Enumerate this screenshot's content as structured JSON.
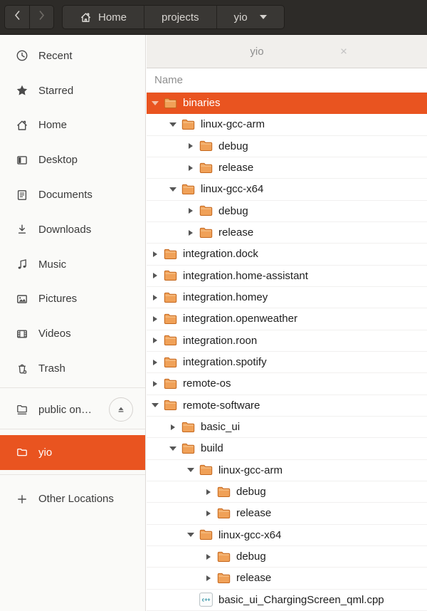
{
  "colors": {
    "accent_orange": "#E95420",
    "header_bg": "#2D2B28",
    "folder_fill": "#F0A158",
    "folder_stroke": "#C4671D",
    "cpp_icon_text": "#2E91A4"
  },
  "header": {
    "back_icon": "chevron-left",
    "forward_icon": "chevron-right",
    "path": [
      {
        "label": "Home",
        "icon": "home"
      },
      {
        "label": "projects"
      },
      {
        "label": "yio",
        "has_caret": true
      }
    ]
  },
  "tab": {
    "title": "yio",
    "close_glyph": "×"
  },
  "list": {
    "column_header": "Name",
    "rows": [
      {
        "name": "binaries",
        "level": 0,
        "state": "expanded",
        "type": "folder",
        "selected": true
      },
      {
        "name": "linux-gcc-arm",
        "level": 1,
        "state": "expanded",
        "type": "folder"
      },
      {
        "name": "debug",
        "level": 2,
        "state": "collapsed",
        "type": "folder"
      },
      {
        "name": "release",
        "level": 2,
        "state": "collapsed",
        "type": "folder"
      },
      {
        "name": "linux-gcc-x64",
        "level": 1,
        "state": "expanded",
        "type": "folder"
      },
      {
        "name": "debug",
        "level": 2,
        "state": "collapsed",
        "type": "folder"
      },
      {
        "name": "release",
        "level": 2,
        "state": "collapsed",
        "type": "folder"
      },
      {
        "name": "integration.dock",
        "level": 0,
        "state": "collapsed",
        "type": "folder"
      },
      {
        "name": "integration.home-assistant",
        "level": 0,
        "state": "collapsed",
        "type": "folder"
      },
      {
        "name": "integration.homey",
        "level": 0,
        "state": "collapsed",
        "type": "folder"
      },
      {
        "name": "integration.openweather",
        "level": 0,
        "state": "collapsed",
        "type": "folder"
      },
      {
        "name": "integration.roon",
        "level": 0,
        "state": "collapsed",
        "type": "folder"
      },
      {
        "name": "integration.spotify",
        "level": 0,
        "state": "collapsed",
        "type": "folder"
      },
      {
        "name": "remote-os",
        "level": 0,
        "state": "collapsed",
        "type": "folder"
      },
      {
        "name": "remote-software",
        "level": 0,
        "state": "expanded",
        "type": "folder"
      },
      {
        "name": "basic_ui",
        "level": 1,
        "state": "collapsed",
        "type": "folder"
      },
      {
        "name": "build",
        "level": 1,
        "state": "expanded",
        "type": "folder"
      },
      {
        "name": "linux-gcc-arm",
        "level": 2,
        "state": "expanded",
        "type": "folder"
      },
      {
        "name": "debug",
        "level": 3,
        "state": "collapsed",
        "type": "folder"
      },
      {
        "name": "release",
        "level": 3,
        "state": "collapsed",
        "type": "folder"
      },
      {
        "name": "linux-gcc-x64",
        "level": 2,
        "state": "expanded",
        "type": "folder"
      },
      {
        "name": "debug",
        "level": 3,
        "state": "collapsed",
        "type": "folder"
      },
      {
        "name": "release",
        "level": 3,
        "state": "collapsed",
        "type": "folder"
      },
      {
        "name": "basic_ui_ChargingScreen_qml.cpp",
        "level": 2,
        "state": "none",
        "type": "cpp-file"
      }
    ]
  },
  "sidebar": {
    "items": [
      {
        "label": "Recent",
        "icon": "clock"
      },
      {
        "label": "Starred",
        "icon": "star"
      },
      {
        "label": "Home",
        "icon": "home"
      },
      {
        "label": "Desktop",
        "icon": "desktop"
      },
      {
        "label": "Documents",
        "icon": "document"
      },
      {
        "label": "Downloads",
        "icon": "download"
      },
      {
        "label": "Music",
        "icon": "music"
      },
      {
        "label": "Pictures",
        "icon": "image"
      },
      {
        "label": "Videos",
        "icon": "video"
      },
      {
        "label": "Trash",
        "icon": "trash"
      }
    ],
    "mounts": [
      {
        "label": "public on…",
        "icon": "network-folder",
        "has_eject": true
      }
    ],
    "bookmarks": [
      {
        "label": "yio",
        "icon": "folder",
        "selected": true
      }
    ],
    "other_locations_label": "Other Locations"
  }
}
